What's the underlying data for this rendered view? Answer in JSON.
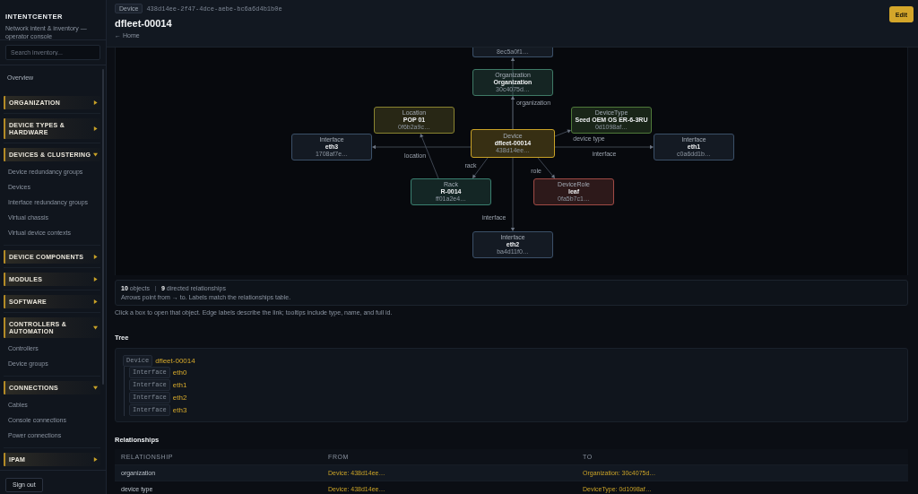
{
  "sidebar": {
    "brand": "INTENTCENTER",
    "tagline": "Network intent & inventory — operator console",
    "search": {
      "placeholder": "Search inventory..."
    },
    "nav": [
      {
        "kind": "link",
        "label": "Overview"
      },
      {
        "kind": "section",
        "label": "ORGANIZATION",
        "expanded": false
      },
      {
        "kind": "section",
        "label": "DEVICE TYPES & HARDWARE",
        "expanded": false
      },
      {
        "kind": "section",
        "label": "DEVICES & CLUSTERING",
        "expanded": true,
        "children": [
          {
            "label": "Device redundancy groups"
          },
          {
            "label": "Devices"
          },
          {
            "label": "Interface redundancy groups"
          },
          {
            "label": "Virtual chassis"
          },
          {
            "label": "Virtual device contexts"
          }
        ]
      },
      {
        "kind": "section",
        "label": "DEVICE COMPONENTS",
        "expanded": false
      },
      {
        "kind": "section",
        "label": "MODULES",
        "expanded": false
      },
      {
        "kind": "section",
        "label": "SOFTWARE",
        "expanded": false
      },
      {
        "kind": "section",
        "label": "CONTROLLERS & AUTOMATION",
        "expanded": true,
        "children": [
          {
            "label": "Controllers"
          },
          {
            "label": "Device groups"
          }
        ]
      },
      {
        "kind": "section",
        "label": "CONNECTIONS",
        "expanded": true,
        "children": [
          {
            "label": "Cables"
          },
          {
            "label": "Console connections"
          },
          {
            "label": "Power connections"
          }
        ]
      },
      {
        "kind": "section",
        "label": "IPAM",
        "expanded": false
      }
    ],
    "sign_out": "Sign out"
  },
  "header": {
    "badge": "Device",
    "uuid": "438d14ee-2f47-4dce-aebe-bc6a6d4b1b0e",
    "title": "dfleet-00014",
    "back_link": "← Home",
    "edit_button": "Edit"
  },
  "graph": {
    "nodes": [
      {
        "id": "8ec5a0f1…",
        "clipped": true,
        "color": "#3b5068"
      },
      {
        "type": "Organization",
        "name": "Organization",
        "id": "30c4075d…",
        "clipped": false,
        "color": "#3f7a66"
      },
      {
        "type": "Location",
        "name": "POP 01",
        "id": "0f6b2a9c…",
        "clipped": false,
        "color": "#8a8430"
      },
      {
        "type": "DeviceType",
        "name": "Seed OEM OS ER-6-3RU",
        "id": "0d1098af…",
        "clipped": false,
        "color": "#4f7a3a"
      },
      {
        "type": "Interface",
        "name": "eth3",
        "id": "1708af7e…",
        "clipped": false,
        "color": "#3b5068"
      },
      {
        "type": "Device",
        "name": "dfleet-00014",
        "id": "438d14ee…",
        "clipped": false,
        "color": "#c9a227"
      },
      {
        "type": "Interface",
        "name": "eth1",
        "id": "c0a6dd1b…",
        "clipped": false,
        "color": "#3b5068"
      },
      {
        "type": "Rack",
        "name": "R-0014",
        "id": "ff01a2e4…",
        "clipped": false,
        "color": "#3a8070"
      },
      {
        "type": "DeviceRole",
        "name": "leaf",
        "id": "0fa5b7c1…",
        "clipped": false,
        "color": "#a04a45"
      },
      {
        "type": "Interface",
        "name": "eth2",
        "id": "ba4d11f0…",
        "clipped": false,
        "color": "#3b5068"
      }
    ],
    "edge_labels": [
      "organization",
      "device type",
      "interface",
      "location",
      "rack",
      "role",
      "interface"
    ]
  },
  "stats": {
    "counts": [
      "**10** objects",
      "**9** directed relationships"
    ],
    "note": "Arrows point from → to. Labels match the relationships table."
  },
  "hint": "Click a box to open that object. Edge labels describe the link; tooltips include type, name, and full id.",
  "tree": {
    "title": "Tree",
    "root": {
      "type": "Device",
      "name": "dfleet-00014",
      "children": [
        {
          "type": "Interface",
          "name": "eth0"
        },
        {
          "type": "Interface",
          "name": "eth1"
        },
        {
          "type": "Interface",
          "name": "eth2"
        },
        {
          "type": "Interface",
          "name": "eth3"
        }
      ]
    }
  },
  "relationships": {
    "title": "Relationships",
    "columns": [
      "RELATIONSHIP",
      "FROM",
      "TO"
    ],
    "rows": [
      [
        "organization",
        "Device: 438d14ee…",
        "Organization: 30c4075d…"
      ],
      [
        "device type",
        "Device: 438d14ee…",
        "DeviceType: 0d1098af…"
      ]
    ]
  }
}
